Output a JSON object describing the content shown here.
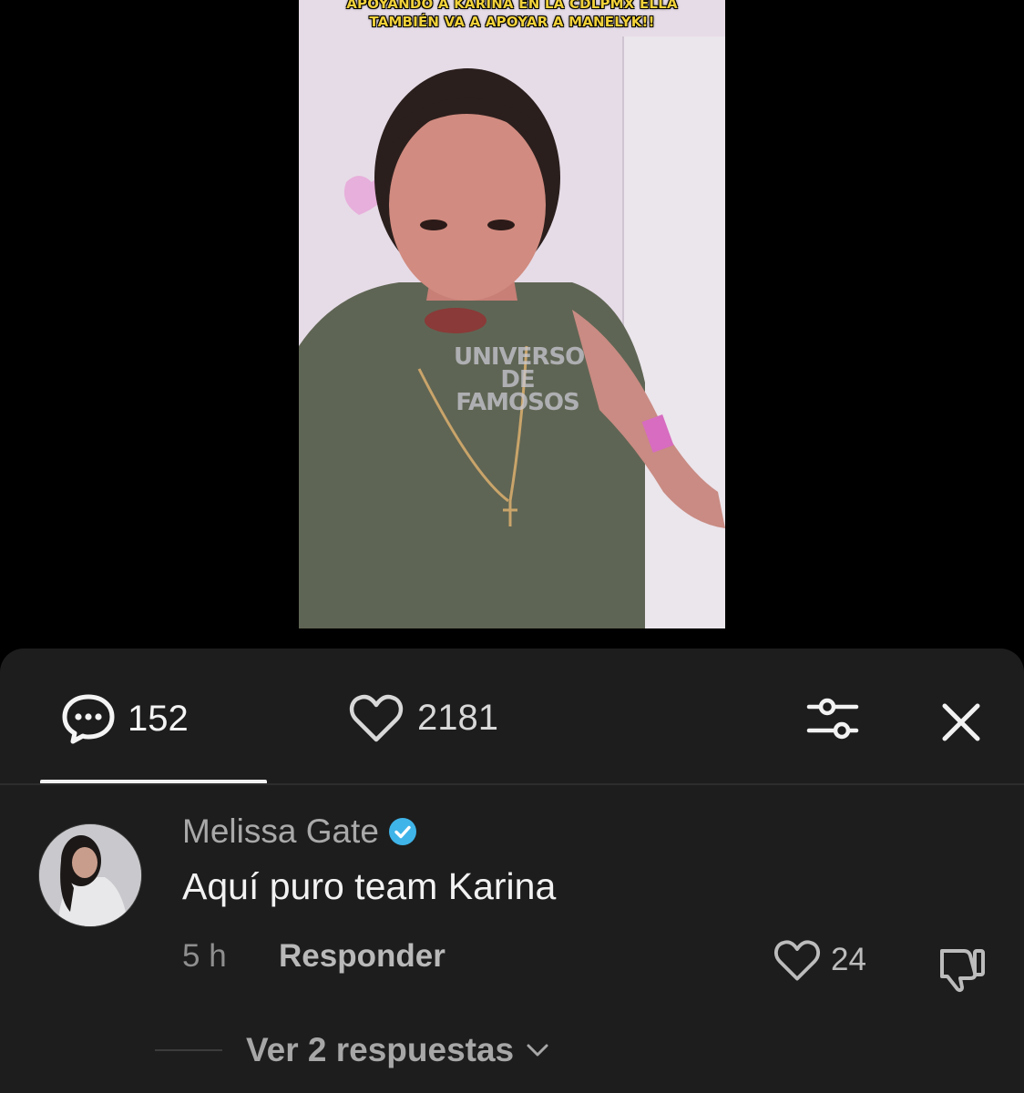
{
  "video": {
    "caption_line1": "APOYANDO A KARINA EN LA CDLPMX ELLA",
    "caption_line2": "TAMBIÉN VA A APOYAR A MANELYK!!",
    "watermark_line1": "UNIVERSO",
    "watermark_line2": "DE",
    "watermark_line3": "FAMOSOS"
  },
  "tabs": {
    "comments_count": "152",
    "likes_count": "2181",
    "active_tab": "comments"
  },
  "comment": {
    "author": "Melissa Gate",
    "verified": true,
    "text": "Aquí puro team Karina",
    "time": "5 h",
    "reply_label": "Responder",
    "likes": "24",
    "view_replies_label": "Ver 2 respuestas"
  },
  "colors": {
    "sheet_bg": "#1d1d1d",
    "verified_badge": "#3fb4e8",
    "caption_yellow": "#f2d23a"
  },
  "icons": [
    "comment-bubble-icon",
    "heart-icon",
    "filter-sliders-icon",
    "close-icon",
    "verified-badge-icon",
    "dislike-icon",
    "chevron-down-icon"
  ]
}
